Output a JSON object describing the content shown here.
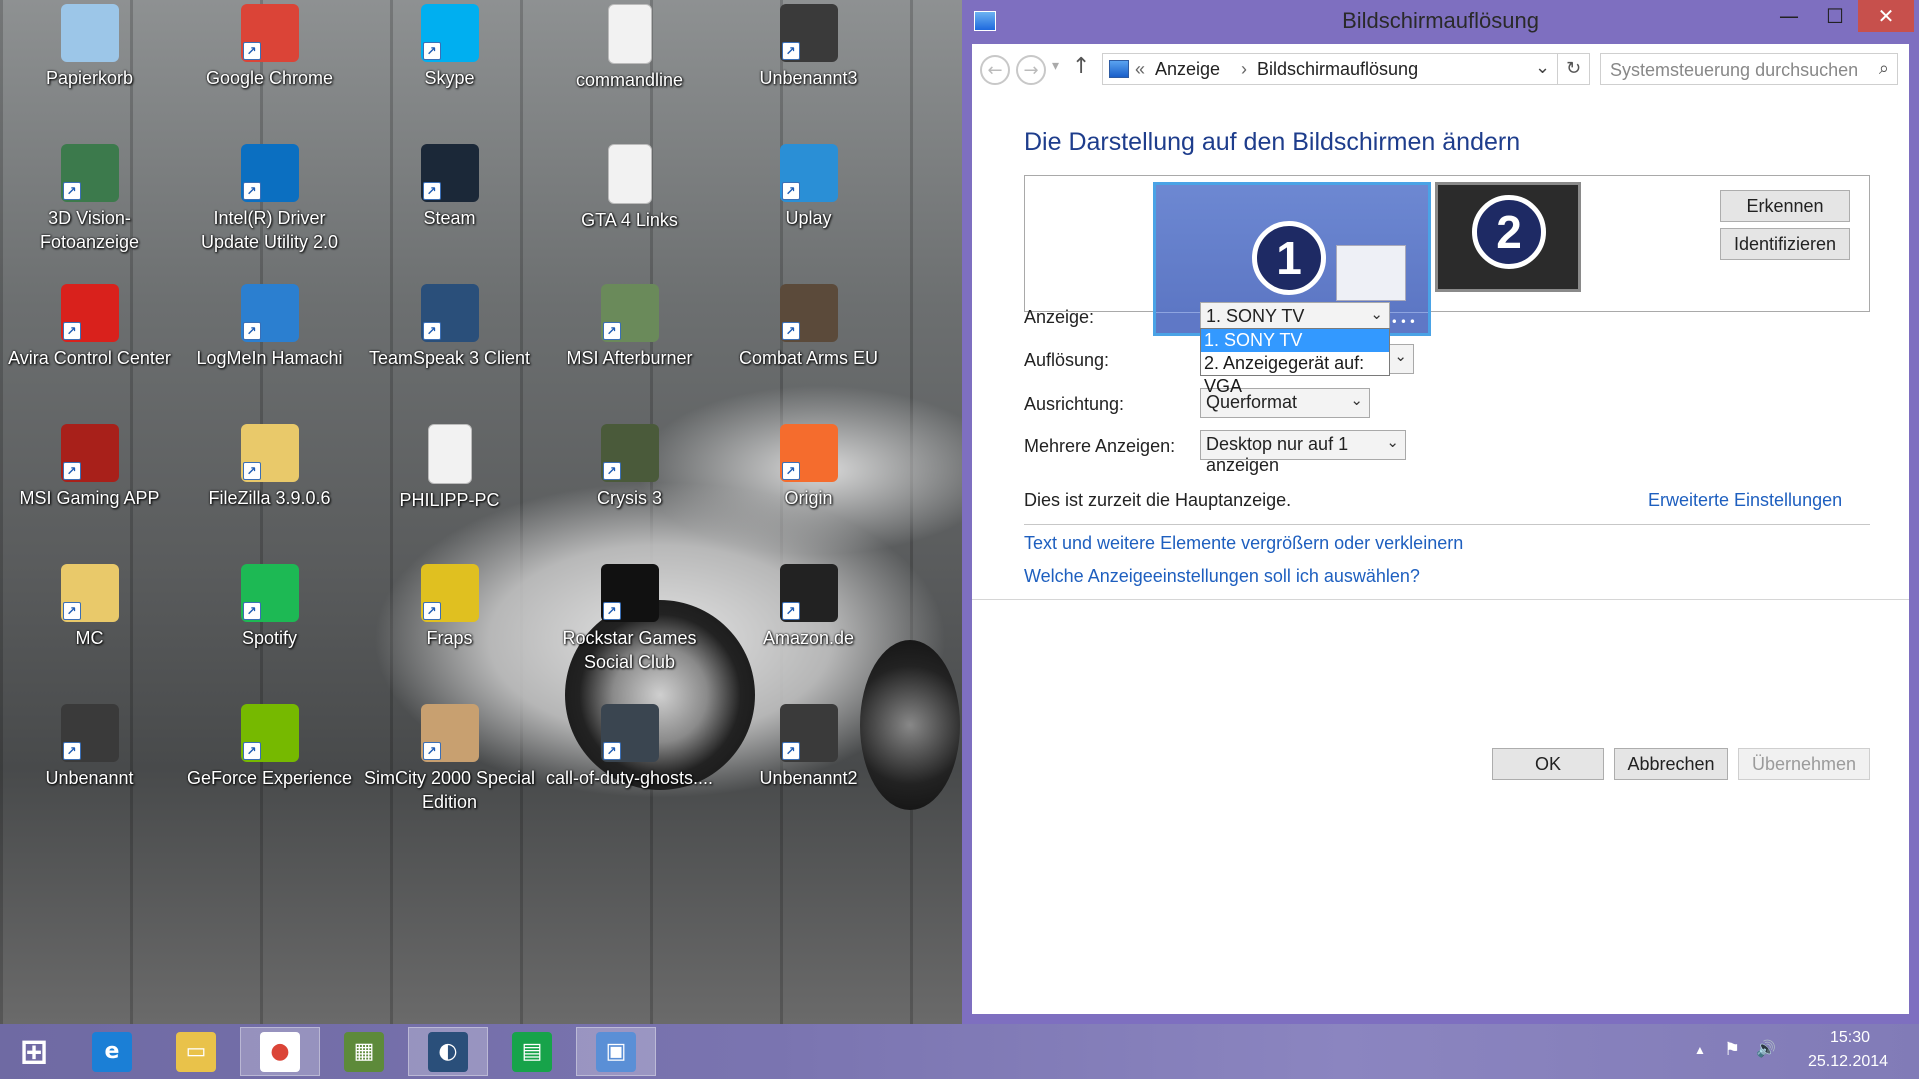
{
  "window": {
    "title": "Bildschirmauflösung",
    "controls": {
      "minimize": "—",
      "maximize": "☐",
      "close": "✕"
    }
  },
  "navigation": {
    "back": "←",
    "forward": "→",
    "recent": "▾",
    "up": "↑",
    "breadcrumb": {
      "separator": "«",
      "items": [
        "Anzeige",
        "Bildschirmauflösung"
      ],
      "arrow": "›"
    },
    "address_dropdown": "⌄",
    "refresh": "↻",
    "search_placeholder": "Systemsteuerung durchsuchen",
    "search_icon": "⌕"
  },
  "content": {
    "heading": "Die Darstellung auf den Bildschirmen ändern",
    "monitors": [
      {
        "number": "1",
        "dots": "•••"
      },
      {
        "number": "2"
      }
    ],
    "buttons": {
      "detect": "Erkennen",
      "identify": "Identifizieren"
    },
    "fields": {
      "display": {
        "label": "Anzeige:",
        "value": "1. SONY TV"
      },
      "resolution": {
        "label": "Auflösung:"
      },
      "orientation": {
        "label": "Ausrichtung:",
        "value": "Querformat"
      },
      "multiple": {
        "label": "Mehrere Anzeigen:",
        "value": "Desktop nur auf 1 anzeigen"
      }
    },
    "chevron": "⌄",
    "dropdown_options": [
      "1. SONY TV",
      "2. Anzeigegerät auf: VGA"
    ],
    "primary_note": "Dies ist zurzeit die Hauptanzeige.",
    "links": {
      "advanced": "Erweiterte Einstellungen",
      "text_size": "Text und weitere Elemente vergrößern oder verkleinern",
      "which_settings": "Welche Anzeigeeinstellungen soll ich auswählen?"
    },
    "dialog_buttons": {
      "ok": "OK",
      "cancel": "Abbrechen",
      "apply": "Übernehmen"
    }
  },
  "desktop": {
    "icons": [
      {
        "label": "Papierkorb",
        "icon": "recycle-bin",
        "color": "#9cc6e8"
      },
      {
        "label": "Google Chrome",
        "icon": "chrome",
        "color": "#db4437"
      },
      {
        "label": "Skype",
        "icon": "skype",
        "color": "#00aff0"
      },
      {
        "label": "commandline",
        "icon": "document",
        "color": "#f2f2f2"
      },
      {
        "label": "Unbenannt3",
        "icon": "screenshot",
        "color": "#3a3a3a"
      },
      {
        "label": "3D Vision-Fotoanzeige",
        "icon": "3d-vision",
        "color": "#3c7a4c"
      },
      {
        "label": "Intel(R) Driver Update Utility 2.0",
        "icon": "intel",
        "color": "#0b6fc1"
      },
      {
        "label": "Steam",
        "icon": "steam",
        "color": "#1b2838"
      },
      {
        "label": "GTA 4 Links",
        "icon": "document",
        "color": "#f2f2f2"
      },
      {
        "label": "Uplay",
        "icon": "uplay",
        "color": "#2a8fd6"
      },
      {
        "label": "Avira Control Center",
        "icon": "avira",
        "color": "#d9211c"
      },
      {
        "label": "LogMeIn Hamachi",
        "icon": "hamachi",
        "color": "#2b7fd0"
      },
      {
        "label": "TeamSpeak 3 Client",
        "icon": "teamspeak",
        "color": "#2a4f7a"
      },
      {
        "label": "MSI Afterburner",
        "icon": "afterburner",
        "color": "#6a8a5a"
      },
      {
        "label": "Combat Arms EU",
        "icon": "combat-arms",
        "color": "#5b4a3a"
      },
      {
        "label": "MSI Gaming APP",
        "icon": "msi-gaming",
        "color": "#a8201a"
      },
      {
        "label": "FileZilla 3.9.0.6",
        "icon": "folder",
        "color": "#e9c96a"
      },
      {
        "label": "PHILIPP-PC",
        "icon": "document",
        "color": "#f2f2f2"
      },
      {
        "label": "Crysis 3",
        "icon": "crysis",
        "color": "#4a5a3a"
      },
      {
        "label": "Origin",
        "icon": "origin",
        "color": "#f56c2d"
      },
      {
        "label": "MC",
        "icon": "folder",
        "color": "#e9c96a"
      },
      {
        "label": "Spotify",
        "icon": "spotify",
        "color": "#1db954"
      },
      {
        "label": "Fraps",
        "icon": "fraps",
        "color": "#e0c020"
      },
      {
        "label": "Rockstar Games Social Club",
        "icon": "rockstar",
        "color": "#111111"
      },
      {
        "label": "Amazon.de",
        "icon": "amazon",
        "color": "#222222"
      },
      {
        "label": "Unbenannt",
        "icon": "screenshot",
        "color": "#3a3a3a"
      },
      {
        "label": "GeForce Experience",
        "icon": "geforce",
        "color": "#76b900"
      },
      {
        "label": "SimCity 2000 Special Edition",
        "icon": "simcity",
        "color": "#c8a070"
      },
      {
        "label": "call-of-duty-ghosts....",
        "icon": "image",
        "color": "#3a4550"
      },
      {
        "label": "Unbenannt2",
        "icon": "screenshot",
        "color": "#3a3a3a"
      }
    ],
    "shortcut_arrow": "↗"
  },
  "taskbar": {
    "pinned": [
      {
        "name": "start",
        "glyph": "⊞"
      },
      {
        "name": "internet-explorer",
        "glyph": "e"
      },
      {
        "name": "file-explorer",
        "glyph": "▭"
      },
      {
        "name": "chrome",
        "glyph": "●"
      },
      {
        "name": "minecraft",
        "glyph": "▦"
      },
      {
        "name": "teamspeak",
        "glyph": "◐"
      },
      {
        "name": "store",
        "glyph": "▤"
      },
      {
        "name": "display-settings",
        "glyph": "▣"
      }
    ],
    "tray": {
      "show_hidden": "▲",
      "flag": "⚑",
      "volume": "🔊",
      "time": "15:30",
      "date": "25.12.2014"
    }
  },
  "colors": {
    "window_frame": "#7e6fc0",
    "heading_blue": "#1e3d8c",
    "link_blue": "#1e5fbf",
    "close_red": "#c7504c",
    "selection_blue": "#3399ff"
  }
}
